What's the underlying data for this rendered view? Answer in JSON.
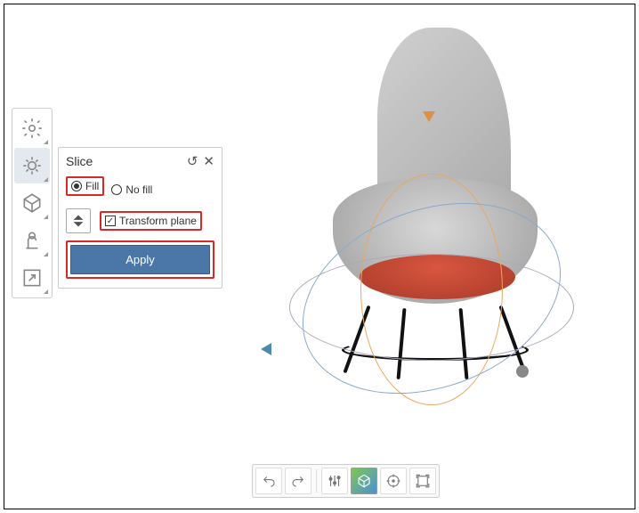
{
  "panel": {
    "title": "Slice",
    "fill_label": "Fill",
    "nofill_label": "No fill",
    "fill_selected": "Fill",
    "transform_label": "Transform plane",
    "transform_checked": true,
    "apply_label": "Apply"
  },
  "left_tools": [
    {
      "name": "settings",
      "active": false
    },
    {
      "name": "slice-tool",
      "active": true
    },
    {
      "name": "mesh-tool",
      "active": false
    },
    {
      "name": "inspect-tool",
      "active": false
    },
    {
      "name": "export-tool",
      "active": false
    }
  ],
  "bottom_tools": [
    {
      "name": "undo"
    },
    {
      "name": "redo"
    },
    {
      "name": "adjust"
    },
    {
      "name": "view-cube",
      "active": true
    },
    {
      "name": "center"
    },
    {
      "name": "bounds"
    }
  ],
  "highlights": [
    "fill-radio-group",
    "transform-plane-checkbox",
    "apply-button"
  ]
}
